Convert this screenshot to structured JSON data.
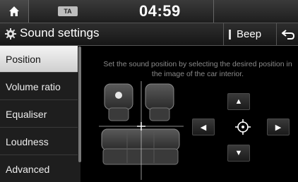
{
  "status_bar": {
    "home_icon": "home-icon",
    "ta_label": "TA",
    "clock": "04:59"
  },
  "title_bar": {
    "icon": "gear-icon",
    "title": "Sound settings",
    "beep_label": "Beep",
    "back_icon": "back-arrow-icon"
  },
  "menu": {
    "items": [
      {
        "label": "Position",
        "active": true
      },
      {
        "label": "Volume ratio",
        "active": false
      },
      {
        "label": "Equaliser",
        "active": false
      },
      {
        "label": "Loudness",
        "active": false
      },
      {
        "label": "Advanced",
        "active": false
      }
    ]
  },
  "content": {
    "instruction": "Set the sound position by selecting the desired position in the image of the car interior.",
    "controls": {
      "up_icon": "triangle-up-icon",
      "down_icon": "triangle-down-icon",
      "left_icon": "triangle-left-icon",
      "right_icon": "triangle-right-icon",
      "center_icon": "crosshair-icon"
    }
  },
  "colors": {
    "background": "#000000",
    "menu_active_bg": "#e6e6e6",
    "instruction_text": "#8a8a8a"
  }
}
